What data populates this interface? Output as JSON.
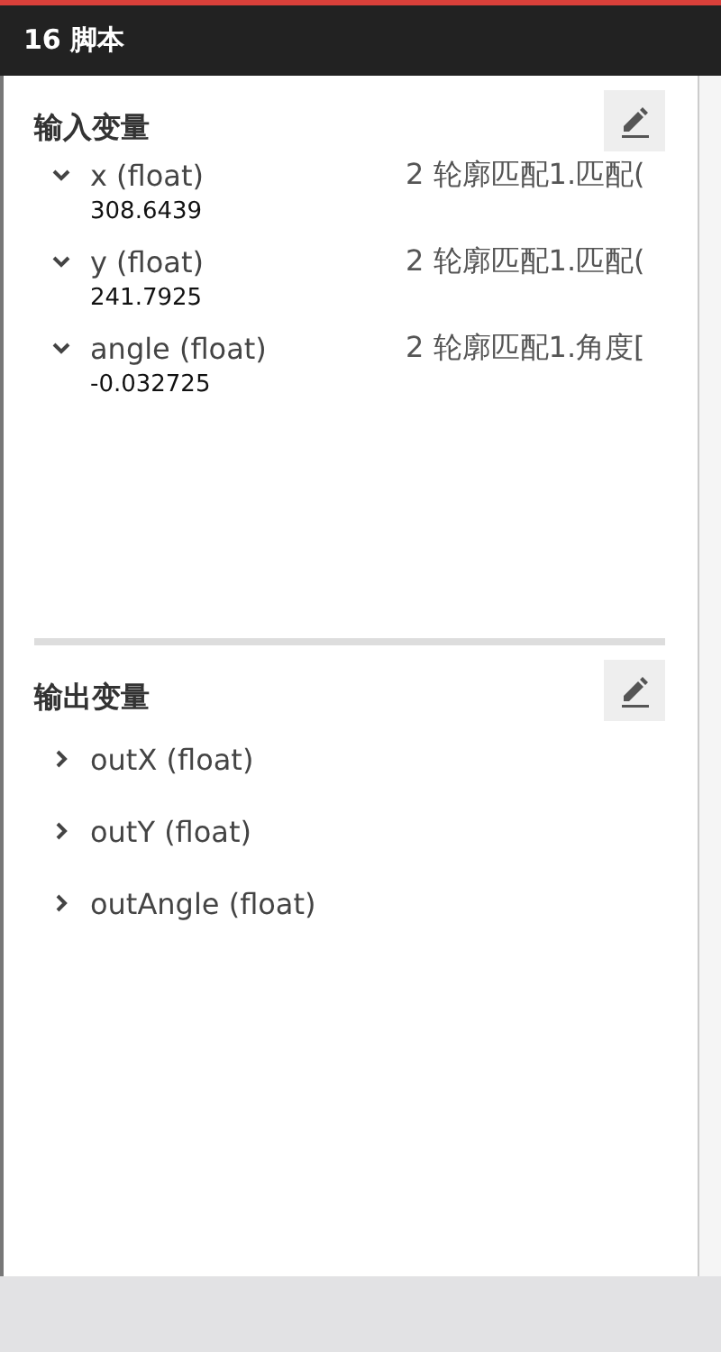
{
  "window": {
    "title": "16 脚本"
  },
  "sections": [
    {
      "title": "输入变量",
      "variables": [
        {
          "name": "x (float)",
          "source": "2 轮廓匹配1.匹配(",
          "value": "308.6439",
          "expanded": true
        },
        {
          "name": "y (float)",
          "source": "2 轮廓匹配1.匹配(",
          "value": "241.7925",
          "expanded": true
        },
        {
          "name": "angle (float)",
          "source": "2 轮廓匹配1.角度[",
          "value": "-0.032725",
          "expanded": true
        }
      ]
    },
    {
      "title": "输出变量",
      "variables": [
        {
          "name": "outX (float)",
          "expanded": false
        },
        {
          "name": "outY (float)",
          "expanded": false
        },
        {
          "name": "outAngle (float)",
          "expanded": false
        }
      ]
    }
  ]
}
